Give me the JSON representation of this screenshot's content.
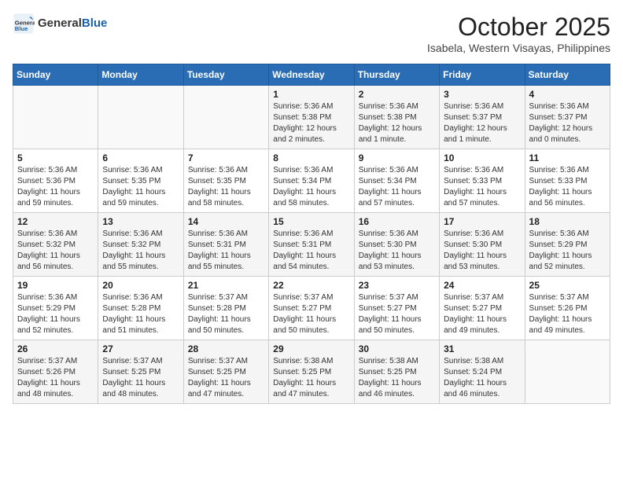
{
  "header": {
    "logo_general": "General",
    "logo_blue": "Blue",
    "month": "October 2025",
    "location": "Isabela, Western Visayas, Philippines"
  },
  "weekdays": [
    "Sunday",
    "Monday",
    "Tuesday",
    "Wednesday",
    "Thursday",
    "Friday",
    "Saturday"
  ],
  "weeks": [
    [
      {
        "day": "",
        "sunrise": "",
        "sunset": "",
        "daylight": ""
      },
      {
        "day": "",
        "sunrise": "",
        "sunset": "",
        "daylight": ""
      },
      {
        "day": "",
        "sunrise": "",
        "sunset": "",
        "daylight": ""
      },
      {
        "day": "1",
        "sunrise": "Sunrise: 5:36 AM",
        "sunset": "Sunset: 5:38 PM",
        "daylight": "Daylight: 12 hours and 2 minutes."
      },
      {
        "day": "2",
        "sunrise": "Sunrise: 5:36 AM",
        "sunset": "Sunset: 5:38 PM",
        "daylight": "Daylight: 12 hours and 1 minute."
      },
      {
        "day": "3",
        "sunrise": "Sunrise: 5:36 AM",
        "sunset": "Sunset: 5:37 PM",
        "daylight": "Daylight: 12 hours and 1 minute."
      },
      {
        "day": "4",
        "sunrise": "Sunrise: 5:36 AM",
        "sunset": "Sunset: 5:37 PM",
        "daylight": "Daylight: 12 hours and 0 minutes."
      }
    ],
    [
      {
        "day": "5",
        "sunrise": "Sunrise: 5:36 AM",
        "sunset": "Sunset: 5:36 PM",
        "daylight": "Daylight: 11 hours and 59 minutes."
      },
      {
        "day": "6",
        "sunrise": "Sunrise: 5:36 AM",
        "sunset": "Sunset: 5:35 PM",
        "daylight": "Daylight: 11 hours and 59 minutes."
      },
      {
        "day": "7",
        "sunrise": "Sunrise: 5:36 AM",
        "sunset": "Sunset: 5:35 PM",
        "daylight": "Daylight: 11 hours and 58 minutes."
      },
      {
        "day": "8",
        "sunrise": "Sunrise: 5:36 AM",
        "sunset": "Sunset: 5:34 PM",
        "daylight": "Daylight: 11 hours and 58 minutes."
      },
      {
        "day": "9",
        "sunrise": "Sunrise: 5:36 AM",
        "sunset": "Sunset: 5:34 PM",
        "daylight": "Daylight: 11 hours and 57 minutes."
      },
      {
        "day": "10",
        "sunrise": "Sunrise: 5:36 AM",
        "sunset": "Sunset: 5:33 PM",
        "daylight": "Daylight: 11 hours and 57 minutes."
      },
      {
        "day": "11",
        "sunrise": "Sunrise: 5:36 AM",
        "sunset": "Sunset: 5:33 PM",
        "daylight": "Daylight: 11 hours and 56 minutes."
      }
    ],
    [
      {
        "day": "12",
        "sunrise": "Sunrise: 5:36 AM",
        "sunset": "Sunset: 5:32 PM",
        "daylight": "Daylight: 11 hours and 56 minutes."
      },
      {
        "day": "13",
        "sunrise": "Sunrise: 5:36 AM",
        "sunset": "Sunset: 5:32 PM",
        "daylight": "Daylight: 11 hours and 55 minutes."
      },
      {
        "day": "14",
        "sunrise": "Sunrise: 5:36 AM",
        "sunset": "Sunset: 5:31 PM",
        "daylight": "Daylight: 11 hours and 55 minutes."
      },
      {
        "day": "15",
        "sunrise": "Sunrise: 5:36 AM",
        "sunset": "Sunset: 5:31 PM",
        "daylight": "Daylight: 11 hours and 54 minutes."
      },
      {
        "day": "16",
        "sunrise": "Sunrise: 5:36 AM",
        "sunset": "Sunset: 5:30 PM",
        "daylight": "Daylight: 11 hours and 53 minutes."
      },
      {
        "day": "17",
        "sunrise": "Sunrise: 5:36 AM",
        "sunset": "Sunset: 5:30 PM",
        "daylight": "Daylight: 11 hours and 53 minutes."
      },
      {
        "day": "18",
        "sunrise": "Sunrise: 5:36 AM",
        "sunset": "Sunset: 5:29 PM",
        "daylight": "Daylight: 11 hours and 52 minutes."
      }
    ],
    [
      {
        "day": "19",
        "sunrise": "Sunrise: 5:36 AM",
        "sunset": "Sunset: 5:29 PM",
        "daylight": "Daylight: 11 hours and 52 minutes."
      },
      {
        "day": "20",
        "sunrise": "Sunrise: 5:36 AM",
        "sunset": "Sunset: 5:28 PM",
        "daylight": "Daylight: 11 hours and 51 minutes."
      },
      {
        "day": "21",
        "sunrise": "Sunrise: 5:37 AM",
        "sunset": "Sunset: 5:28 PM",
        "daylight": "Daylight: 11 hours and 50 minutes."
      },
      {
        "day": "22",
        "sunrise": "Sunrise: 5:37 AM",
        "sunset": "Sunset: 5:27 PM",
        "daylight": "Daylight: 11 hours and 50 minutes."
      },
      {
        "day": "23",
        "sunrise": "Sunrise: 5:37 AM",
        "sunset": "Sunset: 5:27 PM",
        "daylight": "Daylight: 11 hours and 50 minutes."
      },
      {
        "day": "24",
        "sunrise": "Sunrise: 5:37 AM",
        "sunset": "Sunset: 5:27 PM",
        "daylight": "Daylight: 11 hours and 49 minutes."
      },
      {
        "day": "25",
        "sunrise": "Sunrise: 5:37 AM",
        "sunset": "Sunset: 5:26 PM",
        "daylight": "Daylight: 11 hours and 49 minutes."
      }
    ],
    [
      {
        "day": "26",
        "sunrise": "Sunrise: 5:37 AM",
        "sunset": "Sunset: 5:26 PM",
        "daylight": "Daylight: 11 hours and 48 minutes."
      },
      {
        "day": "27",
        "sunrise": "Sunrise: 5:37 AM",
        "sunset": "Sunset: 5:25 PM",
        "daylight": "Daylight: 11 hours and 48 minutes."
      },
      {
        "day": "28",
        "sunrise": "Sunrise: 5:37 AM",
        "sunset": "Sunset: 5:25 PM",
        "daylight": "Daylight: 11 hours and 47 minutes."
      },
      {
        "day": "29",
        "sunrise": "Sunrise: 5:38 AM",
        "sunset": "Sunset: 5:25 PM",
        "daylight": "Daylight: 11 hours and 47 minutes."
      },
      {
        "day": "30",
        "sunrise": "Sunrise: 5:38 AM",
        "sunset": "Sunset: 5:25 PM",
        "daylight": "Daylight: 11 hours and 46 minutes."
      },
      {
        "day": "31",
        "sunrise": "Sunrise: 5:38 AM",
        "sunset": "Sunset: 5:24 PM",
        "daylight": "Daylight: 11 hours and 46 minutes."
      },
      {
        "day": "",
        "sunrise": "",
        "sunset": "",
        "daylight": ""
      }
    ]
  ]
}
